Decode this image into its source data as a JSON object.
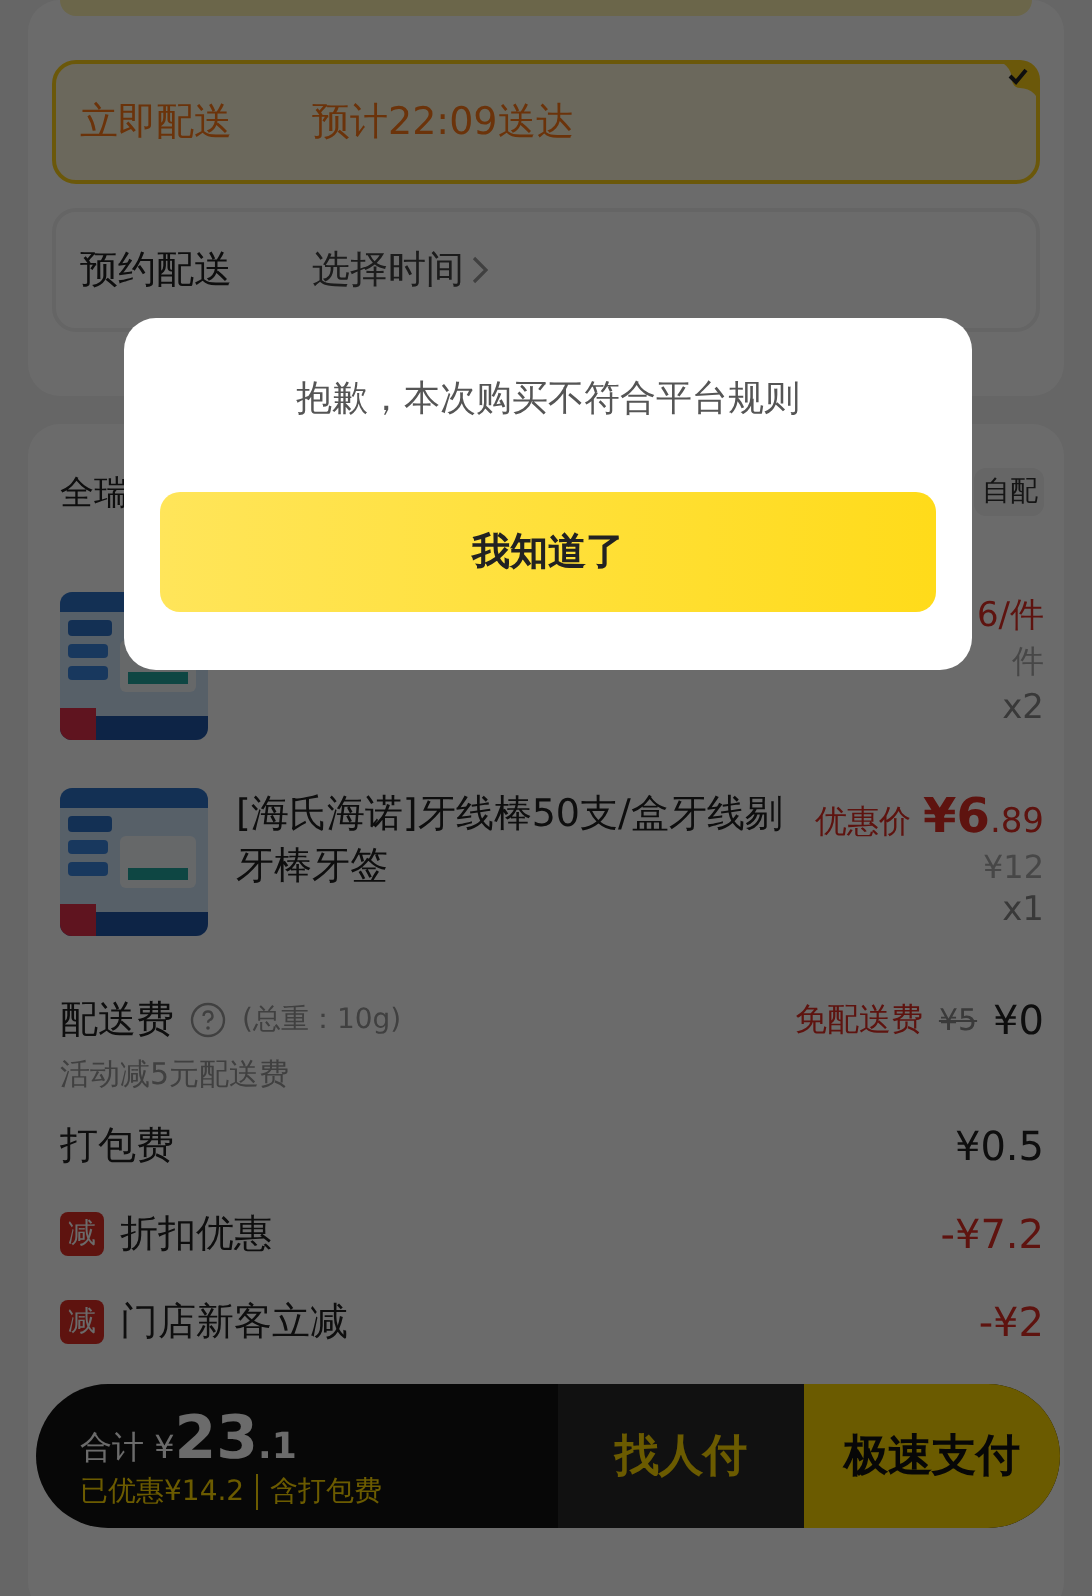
{
  "delivery_options": [
    {
      "label": "立即配送",
      "detail": "预计22:09送达",
      "selected": true
    },
    {
      "label": "预约配送",
      "detail": "选择时间",
      "selected": false
    }
  ],
  "store": {
    "name": "全瑞",
    "tag": "自配"
  },
  "items": [
    {
      "kind": "partial",
      "price": "6/件",
      "original_price": "件",
      "quantity": "x2"
    },
    {
      "kind": "full",
      "title": "[海氏海诺]牙线棒50支/盒牙线剔牙棒牙签",
      "price_label": "优惠价",
      "price": "¥6",
      "price_decimal": ".89",
      "original_price": "¥12",
      "quantity": "x1"
    }
  ],
  "fees": [
    {
      "kind": "delivery",
      "label": "配送费",
      "note": "(总重：10g)",
      "badge": "免配送费",
      "original": "¥5",
      "value": "¥0",
      "sub": "活动减5元配送费"
    },
    {
      "kind": "plain",
      "label": "打包费",
      "value": "¥0.5"
    },
    {
      "kind": "discount",
      "tag": "减",
      "label": "折扣优惠",
      "value": "-¥7.2"
    },
    {
      "kind": "discount",
      "tag": "减",
      "label": "门店新客立减",
      "value": "-¥2"
    }
  ],
  "checkout": {
    "total_label": "合计",
    "currency": "¥",
    "total": "23",
    "total_decimal": ".1",
    "saved": "已优惠¥14.2",
    "includes": "含打包费",
    "buttons": [
      {
        "kind": "secondary",
        "label": "找人付"
      },
      {
        "kind": "primary",
        "label": "极速支付"
      }
    ]
  },
  "dialog": {
    "message": "抱歉，本次购买不符合平台规则",
    "button": "我知道了"
  }
}
